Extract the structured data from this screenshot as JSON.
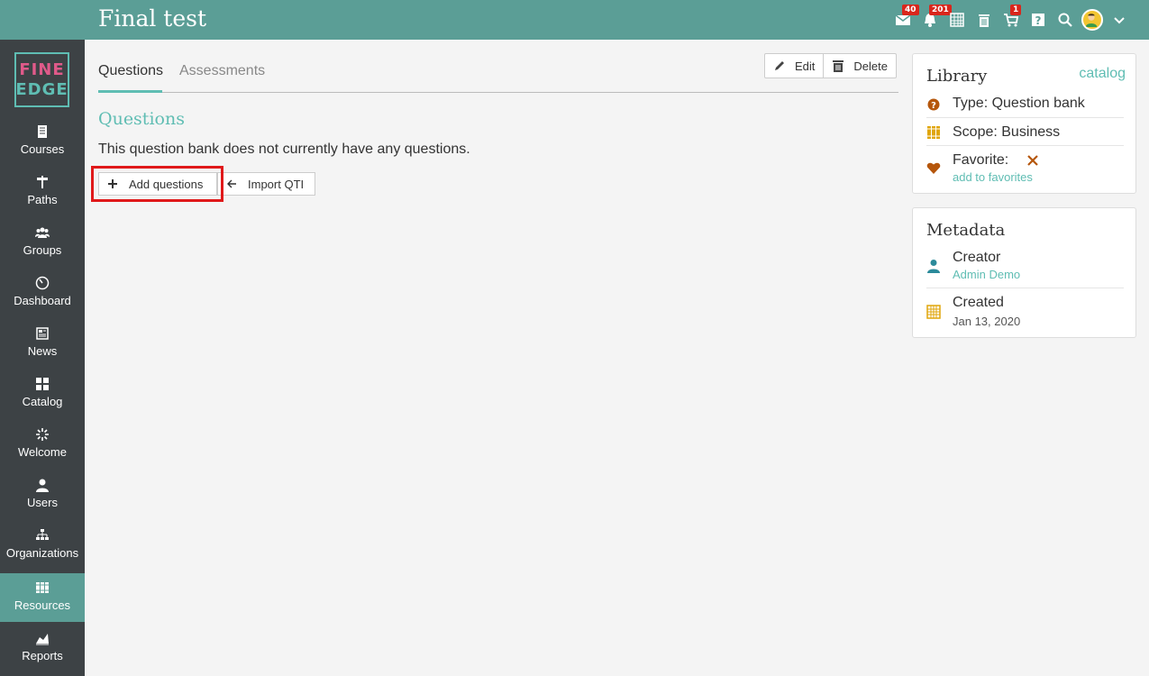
{
  "header": {
    "title": "Final test",
    "badges": {
      "messages": "40",
      "notifications": "201",
      "cart": "1"
    }
  },
  "logo": {
    "line1": "FINE",
    "line2": "EDGE"
  },
  "sidebar": {
    "items": [
      {
        "label": "Courses",
        "icon": "book-icon"
      },
      {
        "label": "Paths",
        "icon": "signpost-icon"
      },
      {
        "label": "Groups",
        "icon": "groups-icon"
      },
      {
        "label": "Dashboard",
        "icon": "gauge-icon"
      },
      {
        "label": "News",
        "icon": "newspaper-icon"
      },
      {
        "label": "Catalog",
        "icon": "grid-icon"
      },
      {
        "label": "Welcome",
        "icon": "sparkle-icon"
      },
      {
        "label": "Users",
        "icon": "user-icon"
      },
      {
        "label": "Organizations",
        "icon": "org-chart-icon"
      },
      {
        "label": "Resources",
        "icon": "books-icon",
        "active": true
      },
      {
        "label": "Reports",
        "icon": "chart-icon"
      }
    ]
  },
  "tabs": [
    {
      "label": "Questions",
      "active": true
    },
    {
      "label": "Assessments"
    }
  ],
  "toolbar": {
    "edit_label": "Edit",
    "delete_label": "Delete"
  },
  "main": {
    "section_title": "Questions",
    "empty_text": "This question bank does not currently have any questions.",
    "add_questions_label": "Add questions",
    "import_qti_label": "Import QTI"
  },
  "library": {
    "title": "Library",
    "catalog_link": "catalog",
    "type": "Type: Question bank",
    "scope": "Scope: Business",
    "favorite": "Favorite:",
    "add_to_favorites": "add to favorites"
  },
  "metadata": {
    "title": "Metadata",
    "creator_label": "Creator",
    "creator_value": "Admin Demo",
    "created_label": "Created",
    "created_value": "Jan 13, 2020"
  },
  "colors": {
    "accent": "#5b9e96",
    "link": "#5fbdb3",
    "sidebar": "#3d4245",
    "highlight": "#e0191a"
  }
}
